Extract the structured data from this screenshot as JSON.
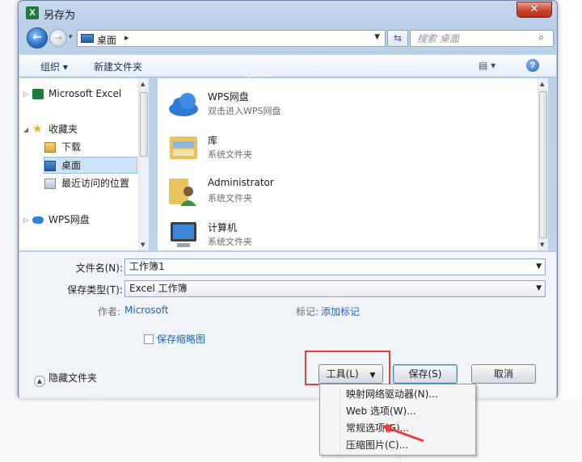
{
  "window": {
    "title": "另存为",
    "app_icon_letter": "X",
    "close_glyph": "✕"
  },
  "navbar": {
    "address_location": "桌面",
    "address_separator": "▸",
    "search_placeholder": "搜索 桌面"
  },
  "toolbar": {
    "organize_label": "组织 ▾",
    "new_folder_label": "新建文件夹",
    "view_label": "▤ ▾",
    "help_glyph": "?"
  },
  "nav_pane": {
    "items": [
      {
        "label": "Microsoft Excel",
        "expander": "▷"
      },
      {
        "label": "收藏夹",
        "expander": "◢"
      },
      {
        "label": "下载",
        "expander": ""
      },
      {
        "label": "桌面",
        "expander": "",
        "selected": true
      },
      {
        "label": "最近访问的位置",
        "expander": ""
      },
      {
        "label": "WPS网盘",
        "expander": "▷"
      }
    ]
  },
  "files": [
    {
      "name": "WPS网盘",
      "subtitle": "双击进入WPS网盘",
      "icon": "cloud-icon"
    },
    {
      "name": "库",
      "subtitle": "系统文件夹",
      "icon": "library-icon"
    },
    {
      "name": "Administrator",
      "subtitle": "系统文件夹",
      "icon": "user-folder-icon"
    },
    {
      "name": "计算机",
      "subtitle": "系统文件夹",
      "icon": "computer-icon"
    }
  ],
  "form": {
    "filename_label": "文件名(N):",
    "filename_value": "工作簿1",
    "filetype_label": "保存类型(T):",
    "filetype_value": "Excel 工作簿",
    "author_label": "作者:",
    "author_value": "Microsoft",
    "tags_label": "标记:",
    "tags_value": "添加标记",
    "thumbnail_label": "保存缩略图"
  },
  "footer": {
    "hide_folders_label": "隐藏文件夹",
    "tools_label": "工具(L)",
    "save_label": "保存(S)",
    "cancel_label": "取消"
  },
  "tools_menu": {
    "items": [
      "映射网络驱动器(N)...",
      "Web 选项(W)...",
      "常规选项(G)...",
      "压缩图片(C)..."
    ]
  },
  "colors": {
    "highlight_box": "#e33d3d",
    "arrow": "#e33d3d",
    "link": "#1c64b8"
  }
}
